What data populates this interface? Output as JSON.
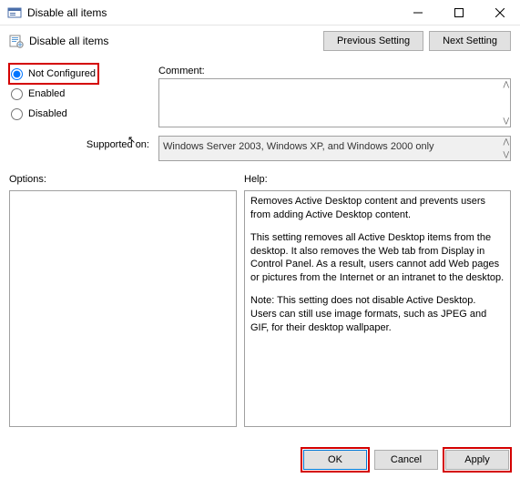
{
  "titlebar": {
    "title": "Disable all items"
  },
  "header": {
    "policy_name": "Disable all items",
    "prev_label": "Previous Setting",
    "next_label": "Next Setting"
  },
  "state": {
    "not_configured_label": "Not Configured",
    "enabled_label": "Enabled",
    "disabled_label": "Disabled",
    "selected": "not_configured"
  },
  "comment": {
    "label": "Comment:",
    "value": ""
  },
  "supported": {
    "label": "Supported on:",
    "value": "Windows Server 2003, Windows XP, and Windows 2000 only"
  },
  "sections": {
    "options_label": "Options:",
    "help_label": "Help:"
  },
  "help": {
    "p1": "Removes Active Desktop content and prevents users from adding Active Desktop content.",
    "p2": "This setting removes all Active Desktop items from the desktop. It also removes the Web tab from Display in Control Panel. As a result, users cannot add Web pages or  pictures from the Internet or an intranet to the desktop.",
    "p3": "Note: This setting does not disable Active Desktop. Users can  still use image formats, such as JPEG and GIF, for their desktop wallpaper."
  },
  "footer": {
    "ok": "OK",
    "cancel": "Cancel",
    "apply": "Apply"
  }
}
